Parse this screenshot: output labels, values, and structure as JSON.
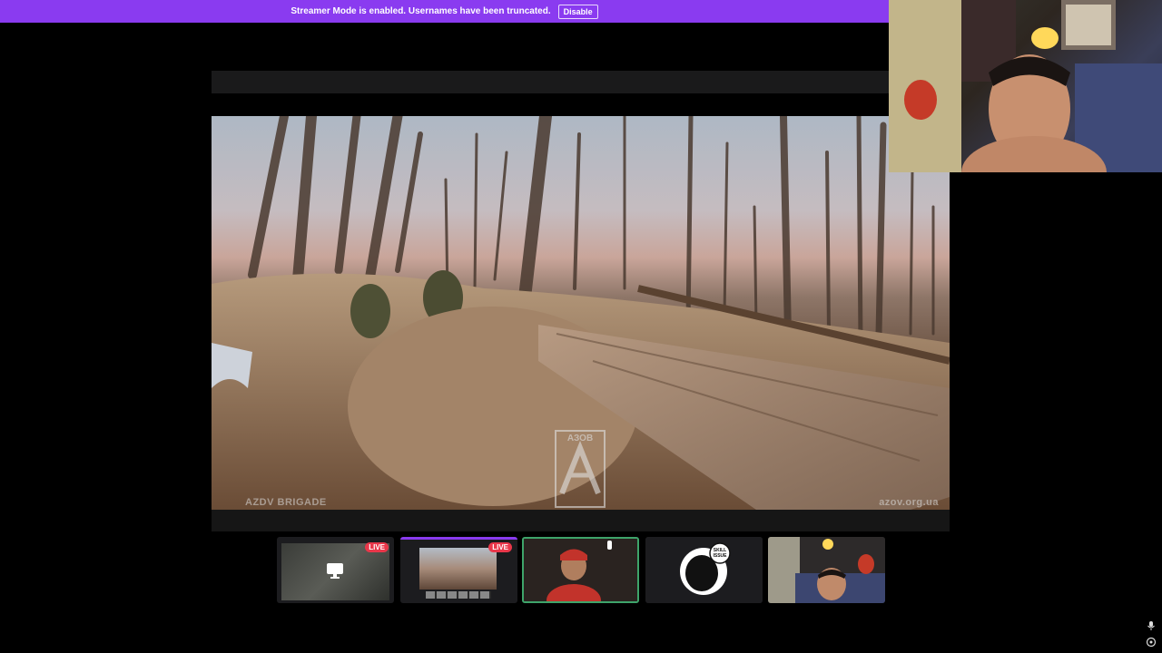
{
  "banner": {
    "message": "Streamer Mode is enabled. Usernames have been truncated.",
    "disable_label": "Disable"
  },
  "stream": {
    "watermark_left": "AZDV BRIGADE",
    "watermark_right": "azov.org.ua",
    "logo_text": "АЗОВ"
  },
  "thumbnails": [
    {
      "name": "screen-share",
      "live": "LIVE"
    },
    {
      "name": "video-feed",
      "live": "LIVE"
    },
    {
      "name": "participant-camera",
      "live": ""
    },
    {
      "name": "skill-issue-avatar",
      "badge": "SKILL ISSUE"
    },
    {
      "name": "self-camera",
      "live": ""
    }
  ],
  "icons": {
    "mic": "microphone-icon",
    "settings": "target-settings-icon",
    "screen": "monitor-icon"
  },
  "colors": {
    "banner": "#8a3bf0",
    "live": "#e9374a",
    "active_speaker": "#3ea46a"
  }
}
